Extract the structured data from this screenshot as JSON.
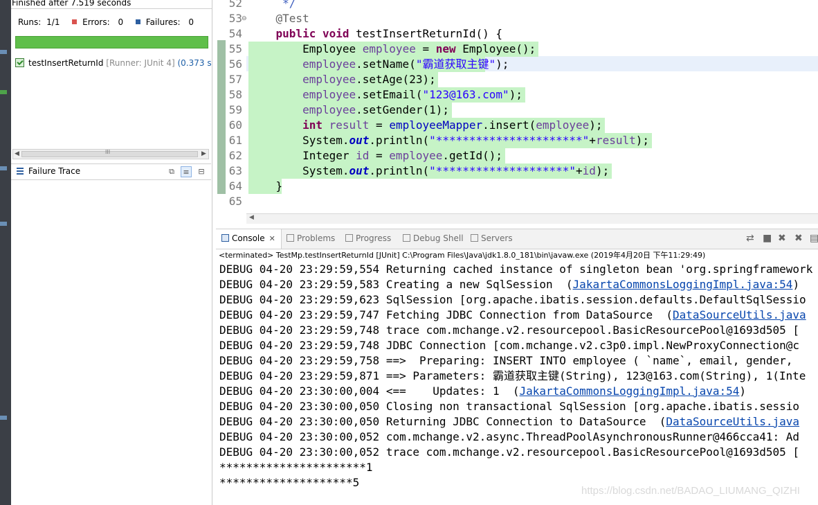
{
  "junit": {
    "status": "Finished after 7.519 seconds",
    "runs_label": "Runs:",
    "runs_value": "1/1",
    "errors_label": "Errors:",
    "errors_value": "0",
    "failures_label": "Failures:",
    "failures_value": "0",
    "success_fraction": 1.0,
    "progress_color": "#5fbf4a",
    "test_name": "testInsertReturnId",
    "test_runner": "[Runner: JUnit 4]",
    "test_time": "(0.373 s",
    "failure_trace_label": "Failure Trace",
    "hscroll_mid": "III"
  },
  "editor": {
    "lines": [
      {
        "n": "52",
        "segs": [
          {
            "t": "     */",
            "c": "cm"
          }
        ]
      },
      {
        "n": "53",
        "segs": [
          {
            "t": "    @Test",
            "c": "ann"
          }
        ]
      },
      {
        "n": "54",
        "segs": [
          {
            "t": "    ",
            "c": ""
          },
          {
            "t": "public",
            "c": "kw"
          },
          {
            "t": " ",
            "c": ""
          },
          {
            "t": "void",
            "c": "kw"
          },
          {
            "t": " testInsertReturnId() {",
            "c": ""
          }
        ]
      },
      {
        "n": "55",
        "segs": [
          {
            "t": "        Employee ",
            "c": ""
          },
          {
            "t": "employee",
            "c": "var"
          },
          {
            "t": " = ",
            "c": ""
          },
          {
            "t": "new",
            "c": "kw"
          },
          {
            "t": " Employee();",
            "c": ""
          }
        ]
      },
      {
        "n": "56",
        "segs": [
          {
            "t": "        ",
            "c": ""
          },
          {
            "t": "employee",
            "c": "var"
          },
          {
            "t": ".setName(",
            "c": ""
          },
          {
            "t": "\"霸道获取主键\"",
            "c": "str"
          },
          {
            "t": ");",
            "c": ""
          }
        ]
      },
      {
        "n": "57",
        "segs": [
          {
            "t": "        ",
            "c": ""
          },
          {
            "t": "employee",
            "c": "var"
          },
          {
            "t": ".setAge(23);",
            "c": ""
          }
        ]
      },
      {
        "n": "58",
        "segs": [
          {
            "t": "        ",
            "c": ""
          },
          {
            "t": "employee",
            "c": "var"
          },
          {
            "t": ".setEmail(",
            "c": ""
          },
          {
            "t": "\"123@163.com\"",
            "c": "str"
          },
          {
            "t": ");",
            "c": ""
          }
        ]
      },
      {
        "n": "59",
        "segs": [
          {
            "t": "        ",
            "c": ""
          },
          {
            "t": "employee",
            "c": "var"
          },
          {
            "t": ".setGender(1);",
            "c": ""
          }
        ]
      },
      {
        "n": "60",
        "segs": [
          {
            "t": "        ",
            "c": ""
          },
          {
            "t": "int",
            "c": "kw"
          },
          {
            "t": " ",
            "c": ""
          },
          {
            "t": "result",
            "c": "var"
          },
          {
            "t": " = ",
            "c": ""
          },
          {
            "t": "employeeMapper",
            "c": "fld"
          },
          {
            "t": ".insert(",
            "c": ""
          },
          {
            "t": "employee",
            "c": "var"
          },
          {
            "t": ");",
            "c": ""
          }
        ]
      },
      {
        "n": "61",
        "segs": [
          {
            "t": "        System.",
            "c": ""
          },
          {
            "t": "out",
            "c": "sf"
          },
          {
            "t": ".println(",
            "c": ""
          },
          {
            "t": "\"**********************\"",
            "c": "str"
          },
          {
            "t": "+",
            "c": ""
          },
          {
            "t": "result",
            "c": "var"
          },
          {
            "t": ");",
            "c": ""
          }
        ]
      },
      {
        "n": "62",
        "segs": [
          {
            "t": "        Integer ",
            "c": ""
          },
          {
            "t": "id",
            "c": "var"
          },
          {
            "t": " = ",
            "c": ""
          },
          {
            "t": "employee",
            "c": "var"
          },
          {
            "t": ".getId();",
            "c": ""
          }
        ]
      },
      {
        "n": "63",
        "segs": [
          {
            "t": "        System.",
            "c": ""
          },
          {
            "t": "out",
            "c": "sf"
          },
          {
            "t": ".println(",
            "c": ""
          },
          {
            "t": "\"********************\"",
            "c": "str"
          },
          {
            "t": "+",
            "c": ""
          },
          {
            "t": "id",
            "c": "var"
          },
          {
            "t": ");",
            "c": ""
          }
        ]
      },
      {
        "n": "64",
        "segs": [
          {
            "t": "    }",
            "c": ""
          }
        ]
      },
      {
        "n": "65",
        "segs": [
          {
            "t": "",
            "c": ""
          }
        ]
      }
    ]
  },
  "console": {
    "tabs": [
      "Console",
      "Problems",
      "Progress",
      "Debug Shell",
      "Servers"
    ],
    "terminated": "<terminated> TestMp.testInsertReturnId [JUnit] C:\\Program Files\\Java\\jdk1.8.0_181\\bin\\javaw.exe (2019年4月20日 下午11:29:49)",
    "lines": [
      {
        "text": "DEBUG 04-20 23:29:59,554 Returning cached instance of singleton bean 'org.springframework",
        "link": ""
      },
      {
        "text": "DEBUG 04-20 23:29:59,583 Creating a new SqlSession  (",
        "link": "JakartaCommonsLoggingImpl.java:54",
        "after": ")"
      },
      {
        "text": "DEBUG 04-20 23:29:59,623 SqlSession [org.apache.ibatis.session.defaults.DefaultSqlSessio",
        "link": ""
      },
      {
        "text": "DEBUG 04-20 23:29:59,747 Fetching JDBC Connection from DataSource  (",
        "link": "DataSourceUtils.java",
        "after": ""
      },
      {
        "text": "DEBUG 04-20 23:29:59,748 trace com.mchange.v2.resourcepool.BasicResourcePool@1693d505 [",
        "link": ""
      },
      {
        "text": "DEBUG 04-20 23:29:59,748 JDBC Connection [com.mchange.v2.c3p0.impl.NewProxyConnection@c",
        "link": ""
      },
      {
        "text": "DEBUG 04-20 23:29:59,758 ==>  Preparing: INSERT INTO employee ( `name`, email, gender,",
        "link": ""
      },
      {
        "text": "DEBUG 04-20 23:29:59,871 ==> Parameters: 霸道获取主键(String), 123@163.com(String), 1(Inte",
        "link": ""
      },
      {
        "text": "DEBUG 04-20 23:30:00,004 <==    Updates: 1  (",
        "link": "JakartaCommonsLoggingImpl.java:54",
        "after": ")"
      },
      {
        "text": "DEBUG 04-20 23:30:00,050 Closing non transactional SqlSession [org.apache.ibatis.sessio",
        "link": ""
      },
      {
        "text": "DEBUG 04-20 23:30:00,050 Returning JDBC Connection to DataSource  (",
        "link": "DataSourceUtils.java",
        "after": ""
      },
      {
        "text": "DEBUG 04-20 23:30:00,052 com.mchange.v2.async.ThreadPoolAsynchronousRunner@466cca41: Ad",
        "link": ""
      },
      {
        "text": "DEBUG 04-20 23:30:00,052 trace com.mchange.v2.resourcepool.BasicResourcePool@1693d505 [",
        "link": ""
      },
      {
        "text": "**********************1",
        "link": ""
      },
      {
        "text": "********************5",
        "link": ""
      }
    ],
    "watermark": "https://blog.csdn.net/BADAO_LIUMANG_QIZHI"
  },
  "colors": {
    "coverage": "#c6f3c6",
    "keyword": "#7f0055",
    "string": "#2a00ff",
    "link": "#0645ad"
  }
}
